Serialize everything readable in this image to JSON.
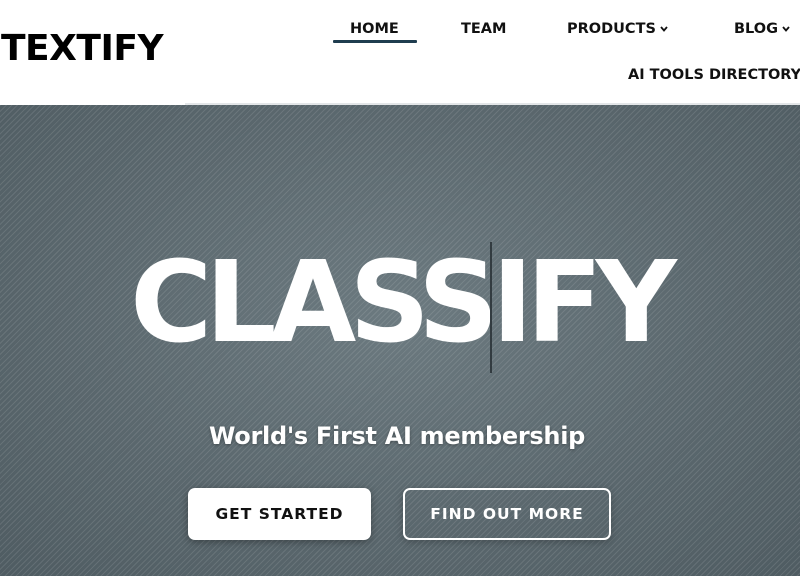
{
  "header": {
    "logo": "TEXTIFY",
    "nav": {
      "home": "HOME",
      "team": "TEAM",
      "products": "PRODUCTS",
      "blog": "BLOG",
      "ai_tools": "AI TOOLS DIRECTORY"
    },
    "active_item": "HOME",
    "accent_color": "#1f3d4f"
  },
  "hero": {
    "title": "CLASSIFY",
    "subtitle": "World's First AI membership",
    "primary_button": "GET STARTED",
    "secondary_button": "FIND OUT MORE",
    "background_color": "#5d6b71"
  },
  "icons": {
    "products_dropdown": "chevron-down-icon",
    "blog_dropdown": "chevron-down-icon"
  }
}
